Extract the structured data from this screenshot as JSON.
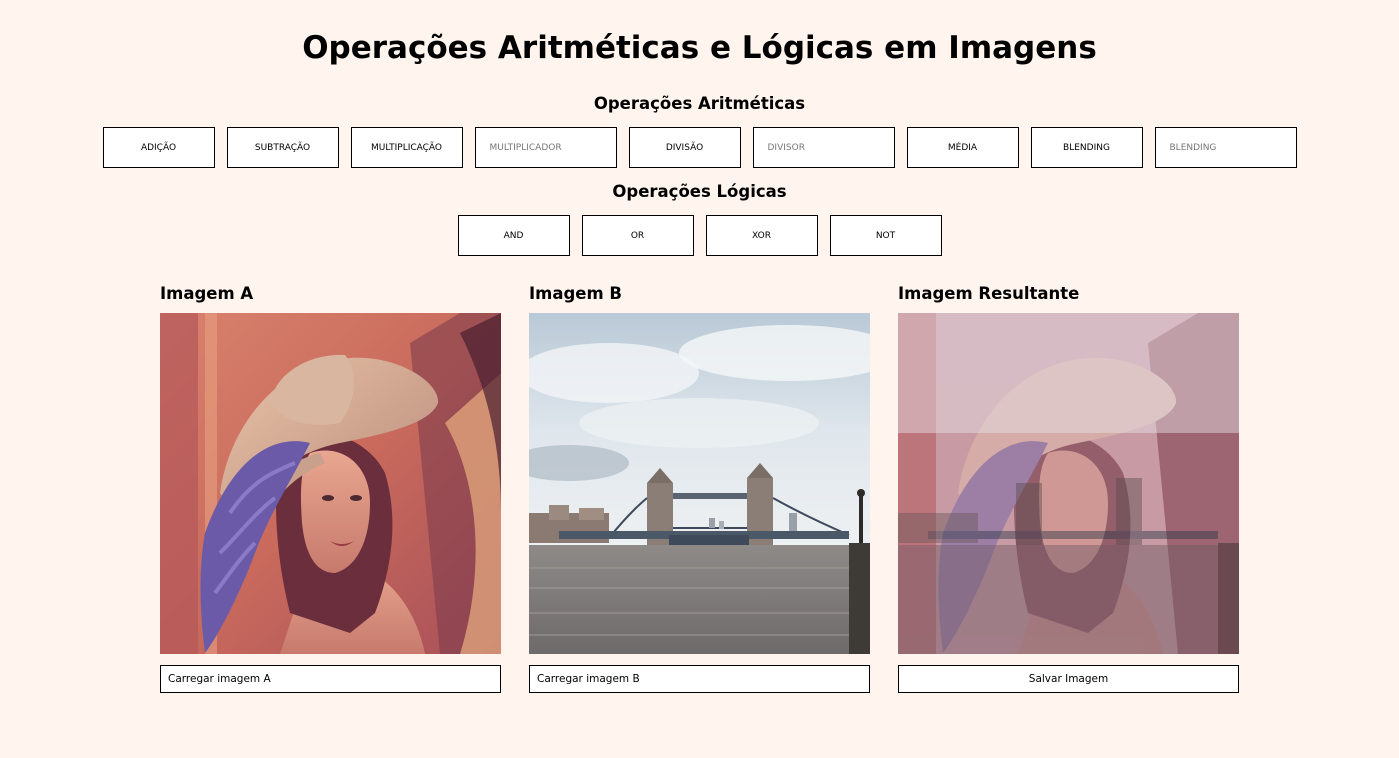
{
  "title": "Operações Aritméticas e Lógicas em Imagens",
  "arithmetic": {
    "heading": "Operações Aritméticas",
    "addition_label": "ADIÇÃO",
    "subtraction_label": "SUBTRAÇÃO",
    "multiplication_label": "MULTIPLICAÇÃO",
    "multiplier_placeholder": "MULTIPLICADOR",
    "division_label": "DIVISÃO",
    "divisor_placeholder": "DIVISOR",
    "average_label": "MÉDIA",
    "blending_label": "BLENDING",
    "blending_placeholder": "BLENDING"
  },
  "logical": {
    "heading": "Operações Lógicas",
    "and_label": "AND",
    "or_label": "OR",
    "xor_label": "XOR",
    "not_label": "NOT"
  },
  "images": {
    "a": {
      "heading": "Imagem A",
      "button_label": "Carregar imagem A",
      "content": "portrait-photo"
    },
    "b": {
      "heading": "Imagem B",
      "button_label": "Carregar imagem B",
      "content": "bridge-river-photo"
    },
    "result": {
      "heading": "Imagem Resultante",
      "button_label": "Salvar Imagem",
      "content": "blended-photo"
    }
  },
  "colors": {
    "page_background": "#fff4ee",
    "border": "#000000"
  }
}
